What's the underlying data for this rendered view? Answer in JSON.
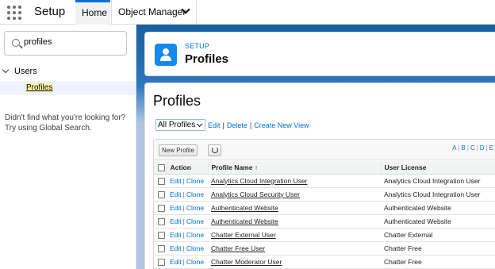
{
  "app": {
    "name": "Setup"
  },
  "tabs": [
    {
      "label": "Home"
    },
    {
      "label": "Object Manager"
    }
  ],
  "sidebar": {
    "search_value": "profiles",
    "tree": {
      "users_label": "Users",
      "profiles_label": "Profiles"
    },
    "not_found_line1": "Didn't find what you're looking for?",
    "not_found_line2": "Try using Global Search."
  },
  "header": {
    "eyebrow": "SETUP",
    "title": "Profiles"
  },
  "content": {
    "title": "Profiles",
    "view_select": "All Profiles",
    "view_links": {
      "edit": "Edit",
      "delete": "Delete",
      "create": "Create New View"
    },
    "new_button": "New Profile",
    "alpha": [
      "A",
      "B",
      "C",
      "D",
      "E"
    ]
  },
  "table": {
    "headers": {
      "action": "Action",
      "name": "Profile Name",
      "name_sort": "↑",
      "license": "User License"
    },
    "action_edit": "Edit",
    "action_clone": "Clone",
    "rows": [
      {
        "name": "Analytics Cloud Integration User",
        "license": "Analytics Cloud Integration User"
      },
      {
        "name": "Analytics Cloud Security User",
        "license": "Analytics Cloud Integration User"
      },
      {
        "name": "Authenticated Website",
        "license": "Authenticated Website"
      },
      {
        "name": "Authenticated Website",
        "license": "Authenticated Website"
      },
      {
        "name": "Chatter External User",
        "license": "Chatter External"
      },
      {
        "name": "Chatter Free User",
        "license": "Chatter Free"
      },
      {
        "name": "Chatter Moderator User",
        "license": "Chatter Free"
      }
    ]
  },
  "colors": {
    "accent": "#0070d2",
    "header_icon": "#1589ee",
    "highlight": "#fff5a6"
  }
}
